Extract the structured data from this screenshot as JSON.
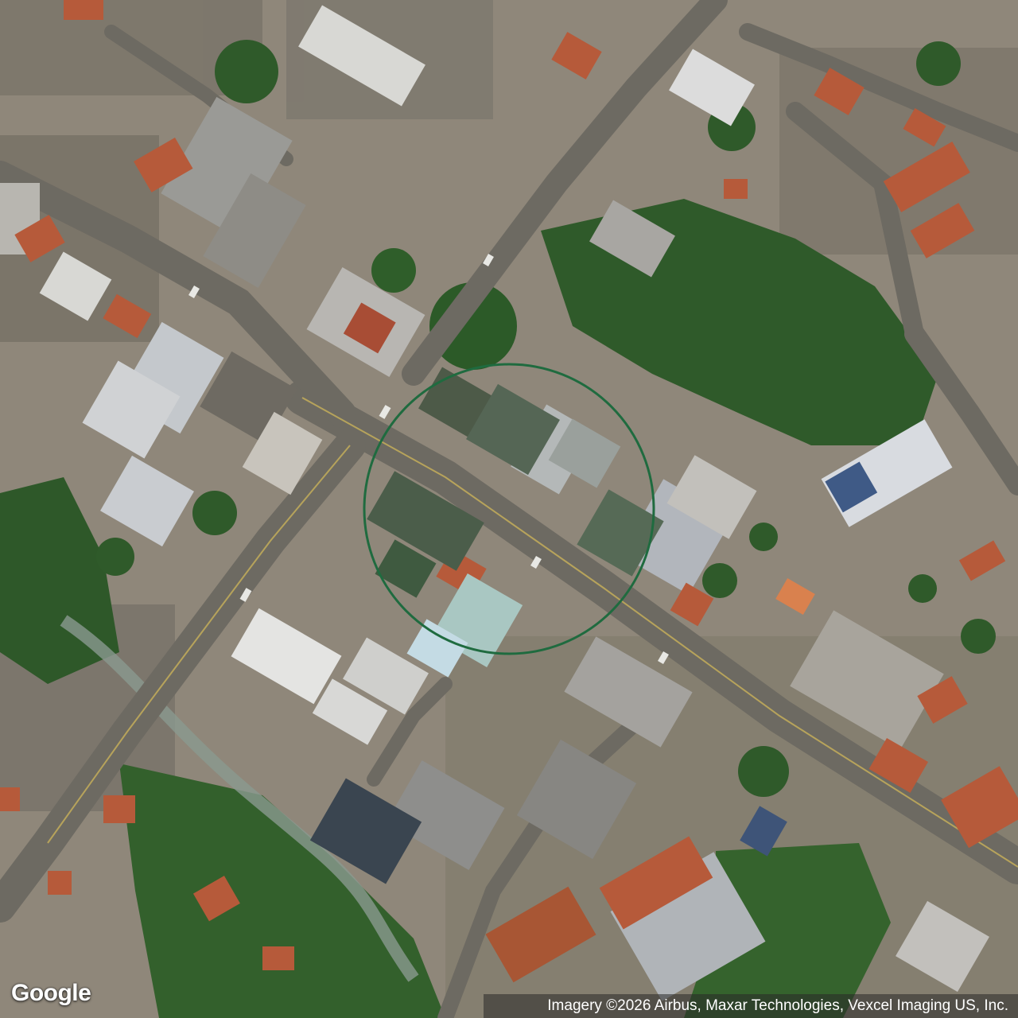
{
  "map": {
    "type": "satellite",
    "subject": "urban-block",
    "highlight": {
      "shape": "circle",
      "color": "#1f6b3f"
    }
  },
  "branding": {
    "logo_text": "Google"
  },
  "attribution": {
    "text": "Imagery ©2026 Airbus, Maxar Technologies, Vexcel Imaging US, Inc."
  },
  "colors": {
    "road": "#6d6a62",
    "vegetation": "#2f5a2a",
    "roof_red": "#b65a3a",
    "roof_grey": "#9a9a96",
    "roof_light": "#d8d8d4"
  }
}
